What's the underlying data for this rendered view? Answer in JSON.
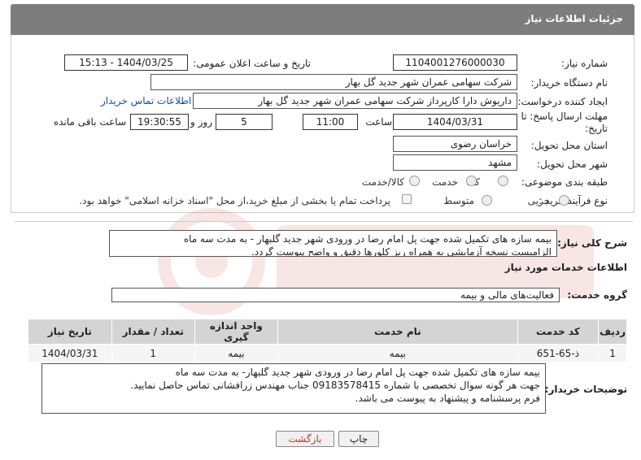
{
  "header": {
    "title": "جزئیات اطلاعات نیاز"
  },
  "form": {
    "need_number_label": "شماره نیاز:",
    "need_number": "1104001276000030",
    "announce_label": "تاریخ و ساعت اعلان عمومی:",
    "announce_value": "1404/03/25 - 15:13",
    "buyer_org_label": "نام دستگاه خریدار:",
    "buyer_org": "شرکت سهامی عمران شهر جدید گل بهار",
    "creator_label": "ایجاد کننده درخواست:",
    "creator": "داریوش دارا کارپرداز شرکت سهامی عمران شهر جدید گل بهار",
    "buyer_contact_link": "اطلاعات تماس خریدار",
    "deadline_label": "مهلت ارسال پاسخ: تا تاریخ:",
    "deadline_date": "1404/03/31",
    "time_label": "ساعت",
    "deadline_time": "11:00",
    "days_value": "5",
    "days_label": "روز و",
    "remaining_time": "19:30:55",
    "remaining_label": "ساعت باقی مانده",
    "province_label": "استان محل تحویل:",
    "province": "خراسان رضوی",
    "city_label": "شهر محل تحویل:",
    "city": "مشهد",
    "category_label": "طبقه بندی موضوعی:",
    "category_options": [
      "کالا",
      "خدمت",
      "کالا/خدمت"
    ],
    "process_label": "نوع فرآیند خرید :",
    "process_options": [
      "جزیی",
      "متوسط"
    ],
    "payment_note": "پرداخت تمام یا بخشی از مبلغ خرید،از محل \"اسناد خزانه اسلامی\" خواهد بود."
  },
  "summary": {
    "label": "شرح کلی نیاز:",
    "line1": "بیمه سازه های تکمیل شده جهت پل امام رضا در ورودی شهر جدید گلبهار - به مدت سه ماه",
    "line2": "الزامیست نسخه آزمایشی به همراه ریز کلورها دقیق و واضح پیوست گردد."
  },
  "services": {
    "section_title": "اطلاعات خدمات مورد نیاز",
    "group_label": "گروه خدمت:",
    "group_value": "فعالیت‌های مالی و بیمه",
    "columns": [
      "ردیف",
      "کد خدمت",
      "نام خدمت",
      "واحد اندازه گیری",
      "تعداد / مقدار",
      "تاریخ نیاز"
    ],
    "rows": [
      [
        "1",
        "ذ-65-651",
        "بیمه",
        "بیمه",
        "1",
        "1404/03/31"
      ]
    ]
  },
  "buyer_notes": {
    "label": "توضیحات خریدار:",
    "line1": "بیمه سازه های تکمیل شده جهت پل امام رضا در ورودی شهر جدید گلبهار- به مدت سه ماه",
    "line2": "جهت هر گونه سوال تخصصی با شماره 09183578415 جناب مهندس زرافشانی تماس حاصل نمایید.",
    "line3": "فرم پرسشنامه و پیشنهاد به پیوست می باشد."
  },
  "buttons": {
    "print": "چاپ",
    "back": "بازگشت"
  },
  "colors": {
    "header_bg": "#7d7d7d",
    "link": "#1a4fa0",
    "back_button_text": "#c0392b",
    "table_header_bg": "#d4d4d4"
  }
}
